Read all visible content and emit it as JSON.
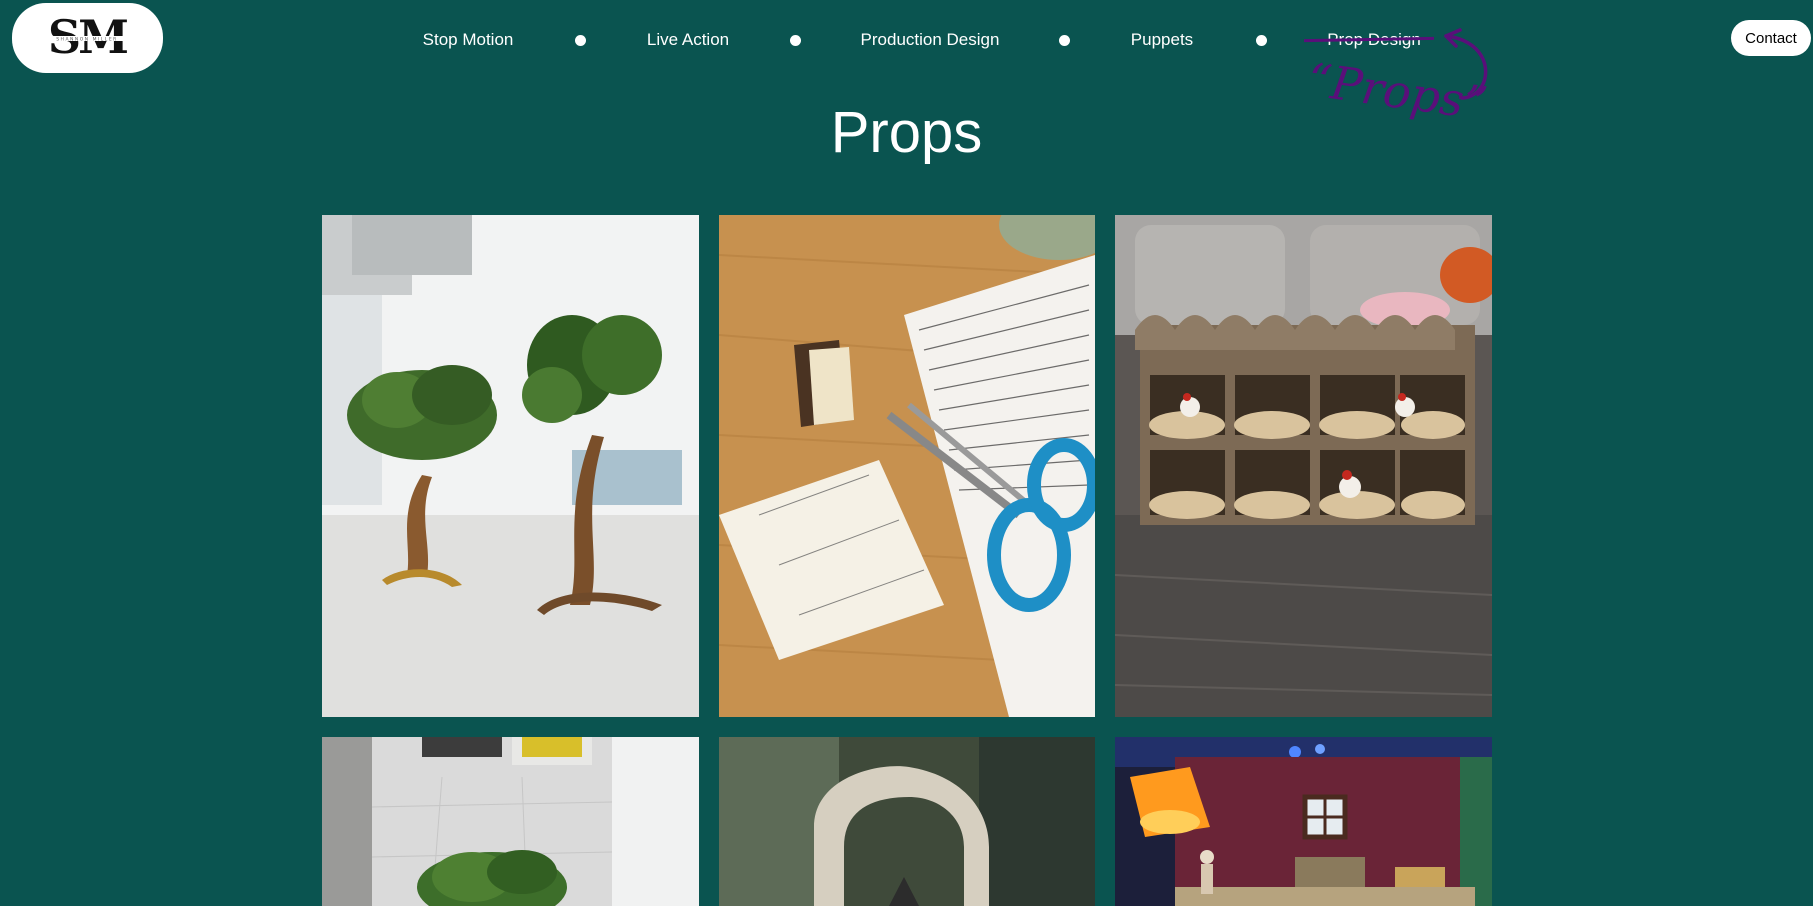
{
  "colors": {
    "background": "#0a5450",
    "annotation": "#5a0f7a"
  },
  "logo": {
    "monogram": "SM",
    "subtitle": "SHANNON MILLER"
  },
  "nav": {
    "items": [
      {
        "label": "Stop Motion"
      },
      {
        "label": "Live Action"
      },
      {
        "label": "Production Design"
      },
      {
        "label": "Puppets"
      },
      {
        "label": "Prop Design"
      }
    ],
    "handwritten_note": "“Props”"
  },
  "contact_label": "Contact",
  "page_title": "Props",
  "gallery": [
    {
      "subject": "two miniature trees on white table"
    },
    {
      "subject": "miniature book, scissors and handwritten pages"
    },
    {
      "subject": "miniature chicken coop with nesting boxes"
    },
    {
      "subject": "miniature green tree on tiled floor"
    },
    {
      "subject": "sculpted arch prop close-up"
    },
    {
      "subject": "miniature barn room set with lamp"
    }
  ]
}
